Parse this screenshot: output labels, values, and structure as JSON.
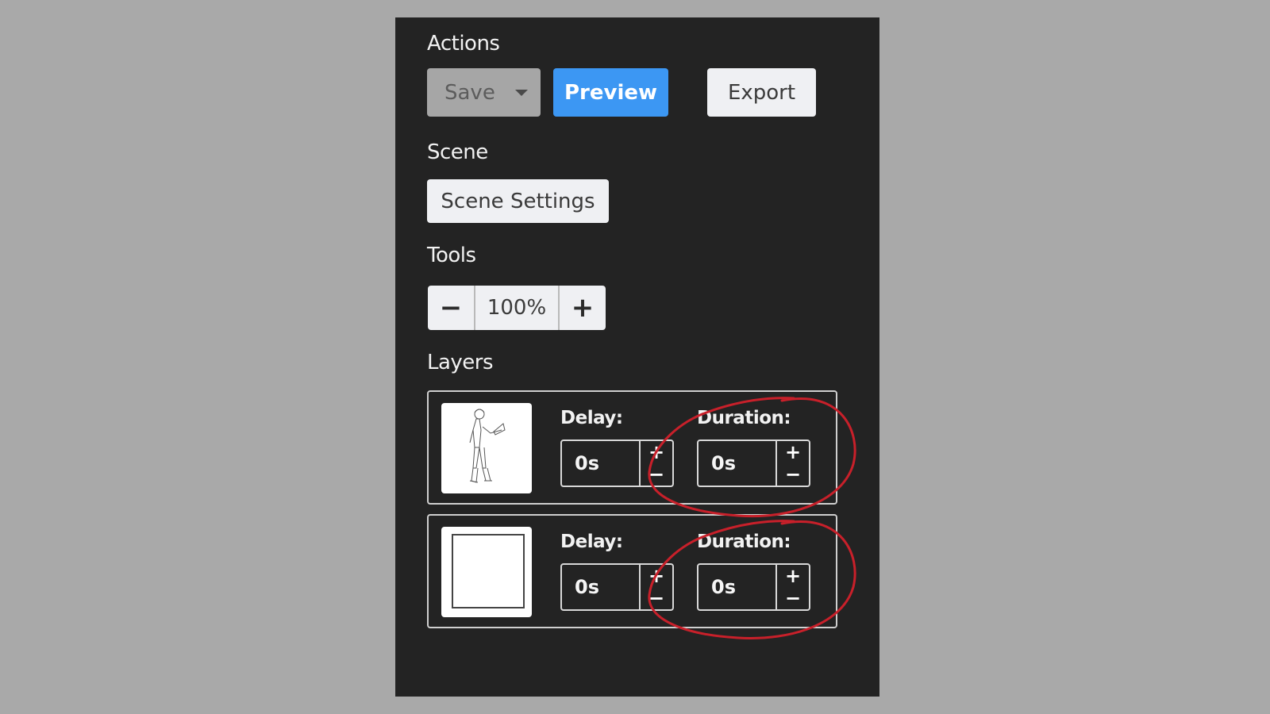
{
  "sections": {
    "actions": "Actions",
    "scene": "Scene",
    "tools": "Tools",
    "layers": "Layers"
  },
  "actions": {
    "save_label": "Save",
    "preview_label": "Preview",
    "export_label": "Export"
  },
  "scene": {
    "settings_label": "Scene Settings"
  },
  "tools": {
    "zoom_out_glyph": "−",
    "zoom_value": "100%",
    "zoom_in_glyph": "+"
  },
  "layers": [
    {
      "thumbnail": "person-with-laptop-sketch",
      "delay_label": "Delay:",
      "delay_value": "0s",
      "duration_label": "Duration:",
      "duration_value": "0s"
    },
    {
      "thumbnail": "blank-frame",
      "delay_label": "Delay:",
      "delay_value": "0s",
      "duration_label": "Duration:",
      "duration_value": "0s"
    }
  ],
  "stepper": {
    "plus_glyph": "+",
    "minus_glyph": "−"
  },
  "colors": {
    "page_background": "#a9a9a9",
    "panel_background": "#232323",
    "accent_blue": "#3c97f3",
    "annotation_red": "#c8202a"
  }
}
